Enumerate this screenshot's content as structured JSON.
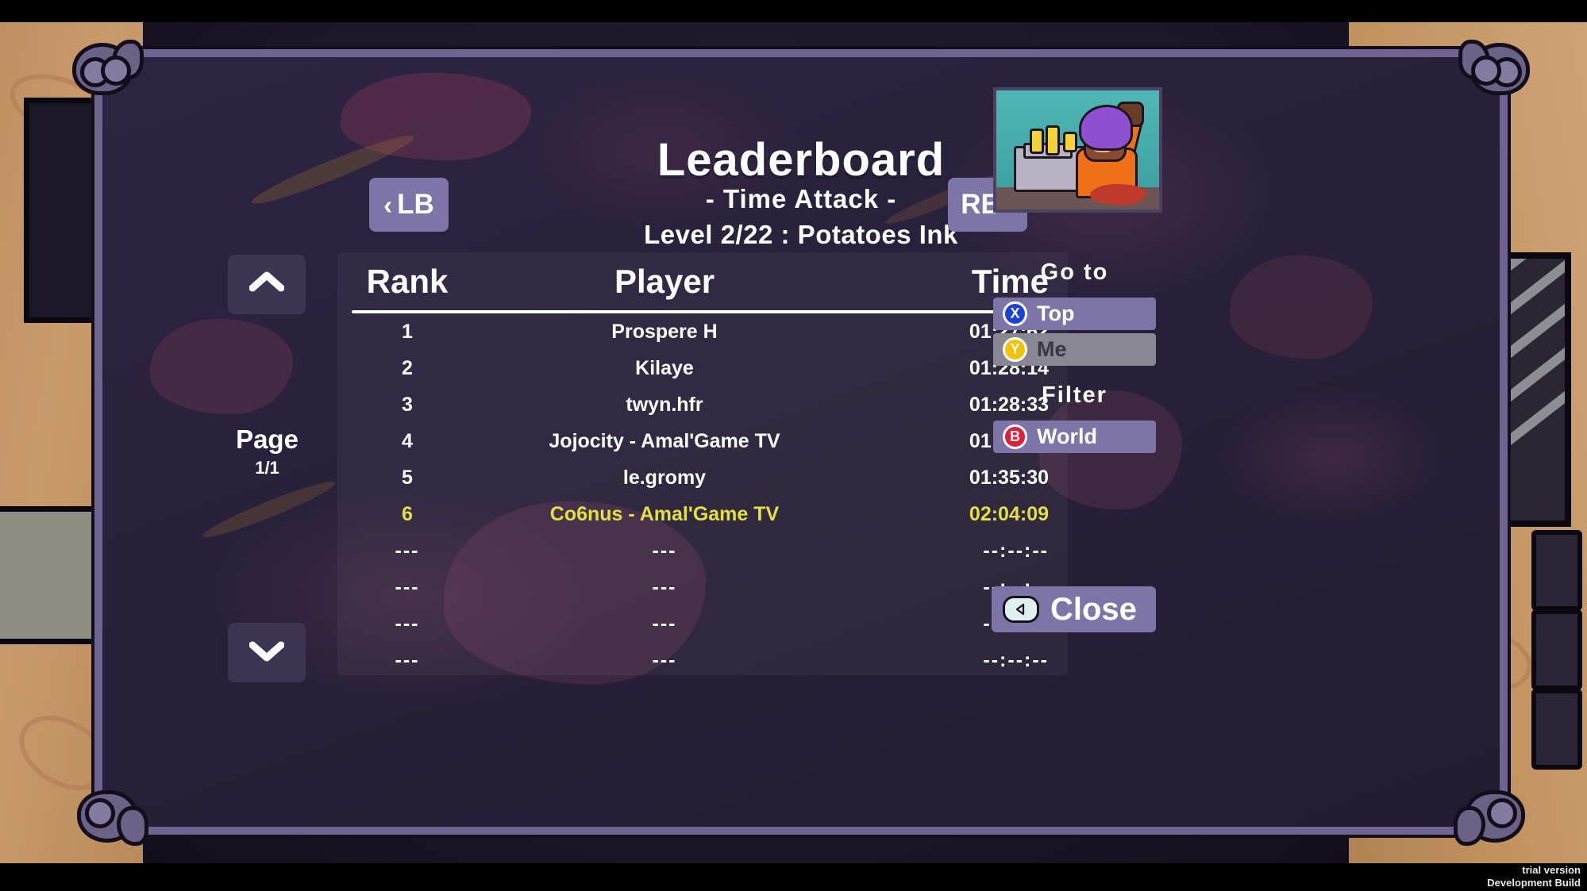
{
  "window": {
    "watermark_line1": "trial version",
    "watermark_line2": "Development Build"
  },
  "header": {
    "title": "Leaderboard",
    "subtitle": "- Time Attack -",
    "level_line": "Level 2/22 : Potatoes Ink",
    "prev_bumper_label": "LB",
    "prev_bumper_chevron": "‹",
    "next_bumper_label": "RB",
    "next_bumper_chevron": "›"
  },
  "pager": {
    "label": "Page",
    "value": "1/1",
    "up_icon": "chevron-up-icon",
    "down_icon": "chevron-down-icon"
  },
  "table": {
    "columns": [
      "Rank",
      "Player",
      "Time"
    ],
    "rows": [
      {
        "rank": "1",
        "player": "Prospere H",
        "time": "01:27:62",
        "state": "normal"
      },
      {
        "rank": "2",
        "player": "Kilaye",
        "time": "01:28:14",
        "state": "normal"
      },
      {
        "rank": "3",
        "player": "twyn.hfr",
        "time": "01:28:33",
        "state": "normal"
      },
      {
        "rank": "4",
        "player": "Jojocity - Amal'Game TV",
        "time": "01:32:21",
        "state": "normal"
      },
      {
        "rank": "5",
        "player": "le.gromy",
        "time": "01:35:30",
        "state": "normal"
      },
      {
        "rank": "6",
        "player": "Co6nus - Amal'Game TV",
        "time": "02:04:09",
        "state": "me"
      },
      {
        "rank": "---",
        "player": "---",
        "time": "--:--:--",
        "state": "empty"
      },
      {
        "rank": "---",
        "player": "---",
        "time": "--:--:--",
        "state": "empty"
      },
      {
        "rank": "---",
        "player": "---",
        "time": "--:--:--",
        "state": "empty"
      },
      {
        "rank": "---",
        "player": "---",
        "time": "--:--:--",
        "state": "empty"
      }
    ]
  },
  "sidebar": {
    "goto_heading": "Go  to",
    "goto_top": {
      "label": "Top",
      "button": "X",
      "enabled": true
    },
    "goto_me": {
      "label": "Me",
      "button": "Y",
      "enabled": false
    },
    "filter_heading": "Filter",
    "filter_world": {
      "label": "World",
      "button": "B"
    },
    "close": {
      "label": "Close",
      "icon": "back-button-icon"
    }
  },
  "colors": {
    "panel_border": "#6e6492",
    "panel_bg": "#2b2340",
    "button_purple": "#7d75a8",
    "highlight_yellow": "#e3e03f",
    "disabled_grey": "#8a8794",
    "xbutton_blue": "#1c41d8",
    "ybutton_yellow": "#f2c20c",
    "bbutton_red": "#e0203a",
    "text_white": "#ffffff"
  }
}
